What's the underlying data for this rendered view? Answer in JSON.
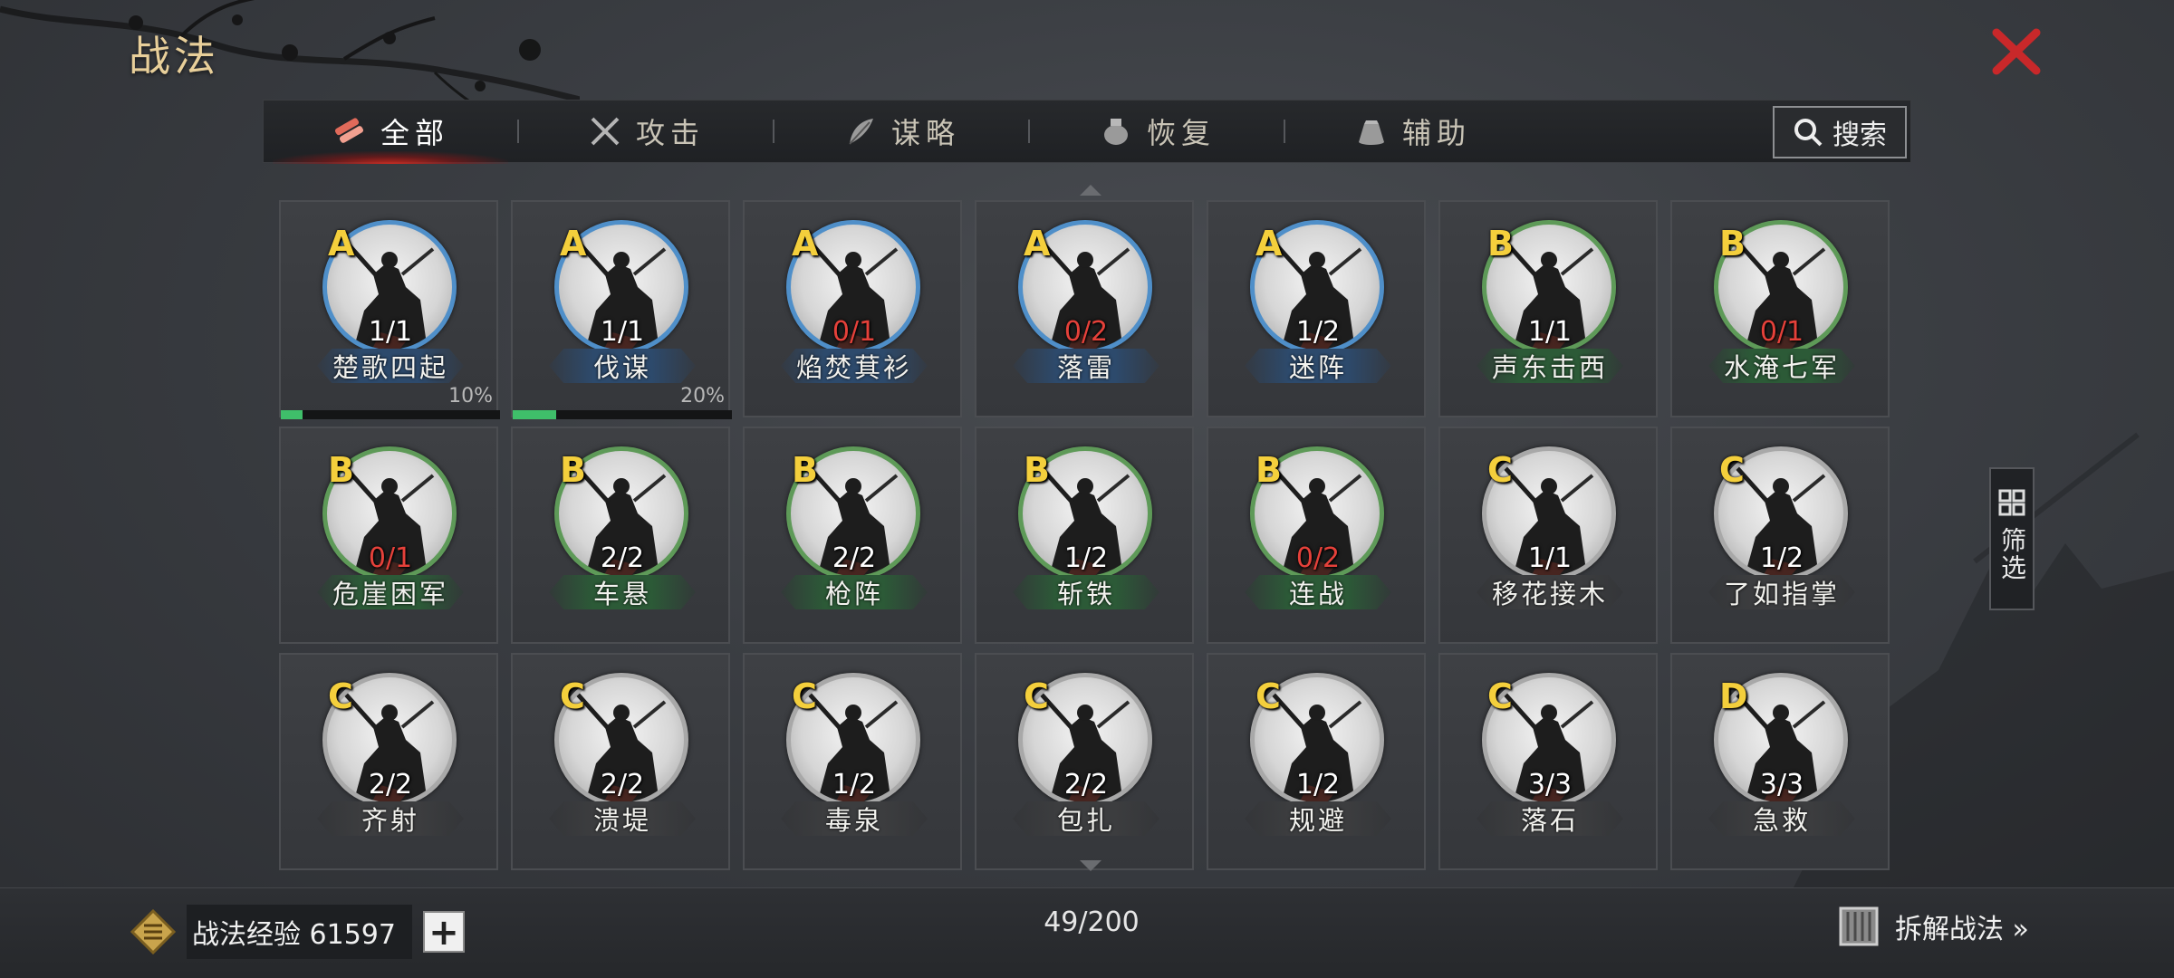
{
  "header": {
    "title": "战法"
  },
  "tabs": [
    {
      "label": "全部",
      "icon": "scroll-bundle-icon",
      "active": true
    },
    {
      "label": "攻击",
      "icon": "crossed-swords-icon",
      "active": false
    },
    {
      "label": "谋略",
      "icon": "feather-fan-icon",
      "active": false
    },
    {
      "label": "恢复",
      "icon": "medicine-pot-icon",
      "active": false
    },
    {
      "label": "辅助",
      "icon": "pouch-icon",
      "active": false
    }
  ],
  "search": {
    "label": "搜索"
  },
  "filter": {
    "label": "筛选"
  },
  "skills": [
    {
      "grade": "A",
      "count": "1/1",
      "count_red": false,
      "name": "楚歌四起",
      "progress": 0.1,
      "progress_label": "10%"
    },
    {
      "grade": "A",
      "count": "1/1",
      "count_red": false,
      "name": "伐谋",
      "progress": 0.2,
      "progress_label": "20%"
    },
    {
      "grade": "A",
      "count": "0/1",
      "count_red": true,
      "name": "焰焚萁衫"
    },
    {
      "grade": "A",
      "count": "0/2",
      "count_red": true,
      "name": "落雷"
    },
    {
      "grade": "A",
      "count": "1/2",
      "count_red": false,
      "name": "迷阵"
    },
    {
      "grade": "B",
      "count": "1/1",
      "count_red": false,
      "name": "声东击西"
    },
    {
      "grade": "B",
      "count": "0/1",
      "count_red": true,
      "name": "水淹七军"
    },
    {
      "grade": "B",
      "count": "0/1",
      "count_red": true,
      "name": "危崖困军"
    },
    {
      "grade": "B",
      "count": "2/2",
      "count_red": false,
      "name": "车悬"
    },
    {
      "grade": "B",
      "count": "2/2",
      "count_red": false,
      "name": "枪阵"
    },
    {
      "grade": "B",
      "count": "1/2",
      "count_red": false,
      "name": "斩铁"
    },
    {
      "grade": "B",
      "count": "0/2",
      "count_red": true,
      "name": "连战"
    },
    {
      "grade": "C",
      "count": "1/1",
      "count_red": false,
      "name": "移花接木"
    },
    {
      "grade": "C",
      "count": "1/2",
      "count_red": false,
      "name": "了如指掌"
    },
    {
      "grade": "C",
      "count": "2/2",
      "count_red": false,
      "name": "齐射"
    },
    {
      "grade": "C",
      "count": "2/2",
      "count_red": false,
      "name": "溃堤"
    },
    {
      "grade": "C",
      "count": "1/2",
      "count_red": false,
      "name": "毒泉"
    },
    {
      "grade": "C",
      "count": "2/2",
      "count_red": false,
      "name": "包扎"
    },
    {
      "grade": "C",
      "count": "1/2",
      "count_red": false,
      "name": "规避"
    },
    {
      "grade": "C",
      "count": "3/3",
      "count_red": false,
      "name": "落石"
    },
    {
      "grade": "D",
      "count": "3/3",
      "count_red": false,
      "name": "急救"
    }
  ],
  "footer": {
    "exp_label": "战法经验 61597",
    "plus": "+",
    "capacity": "49/200",
    "disassemble_label": "拆解战法 »"
  },
  "colors": {
    "grade_text": "#f4cf3c",
    "count_red": "#e5413a",
    "progress": "#3fbf6a",
    "tab_active_glow": "#d2281e"
  }
}
